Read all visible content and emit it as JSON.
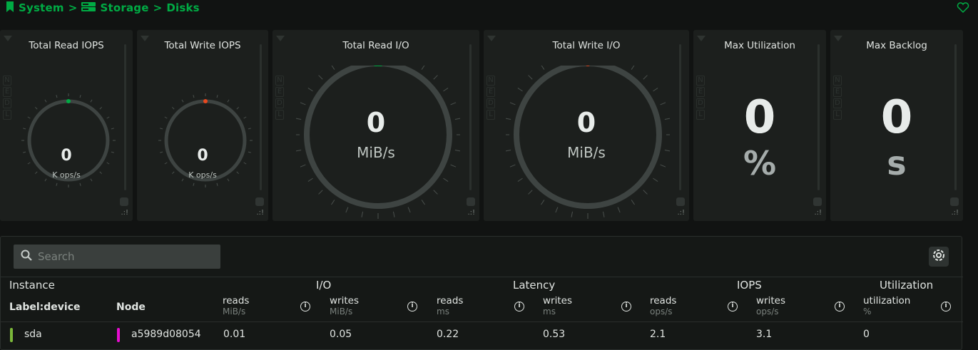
{
  "breadcrumb": {
    "part1": "System",
    "sep1": ">",
    "part2": "Storage",
    "sep2": ">",
    "part3": "Disks"
  },
  "colors": {
    "accent": "#00ab44",
    "read_marker": "#00ab44",
    "write_marker": "#e8481f",
    "device_marker": "#7bb83a",
    "node_marker": "#e60dd0"
  },
  "cards": {
    "read_iops": {
      "title": "Total Read IOPS",
      "value": "0",
      "unit": "K ops/s"
    },
    "write_iops": {
      "title": "Total Write IOPS",
      "value": "0",
      "unit": "K ops/s"
    },
    "read_io": {
      "title": "Total Read I/O",
      "value": "0",
      "unit": "MiB/s"
    },
    "write_io": {
      "title": "Total Write I/O",
      "value": "0",
      "unit": "MiB/s"
    },
    "max_util": {
      "title": "Max Utilization",
      "value": "0",
      "unit": "%"
    },
    "max_backlog": {
      "title": "Max Backlog",
      "value": "0",
      "unit": "s"
    }
  },
  "side_letters": [
    "N",
    "E",
    "D",
    "L"
  ],
  "search": {
    "placeholder": "Search"
  },
  "table": {
    "groups": {
      "instance": "Instance",
      "io": "I/O",
      "latency": "Latency",
      "iops": "IOPS",
      "utilization": "Utilization"
    },
    "columns": {
      "device": "Label:device",
      "node": "Node",
      "io_reads": {
        "label": "reads",
        "unit": "MiB/s"
      },
      "io_writes": {
        "label": "writes",
        "unit": "MiB/s"
      },
      "lat_reads": {
        "label": "reads",
        "unit": "ms"
      },
      "lat_writes": {
        "label": "writes",
        "unit": "ms"
      },
      "iops_reads": {
        "label": "reads",
        "unit": "ops/s"
      },
      "iops_writes": {
        "label": "writes",
        "unit": "ops/s"
      },
      "util": {
        "label": "utilization",
        "unit": "%"
      }
    },
    "info_glyph": "i",
    "rows": [
      {
        "device": "sda",
        "node": "a5989d08054",
        "io_reads": "0.01",
        "io_writes": "0.05",
        "lat_reads": "0.22",
        "lat_writes": "0.53",
        "iops_reads": "2.1",
        "iops_writes": "3.1",
        "util": "0"
      }
    ]
  }
}
